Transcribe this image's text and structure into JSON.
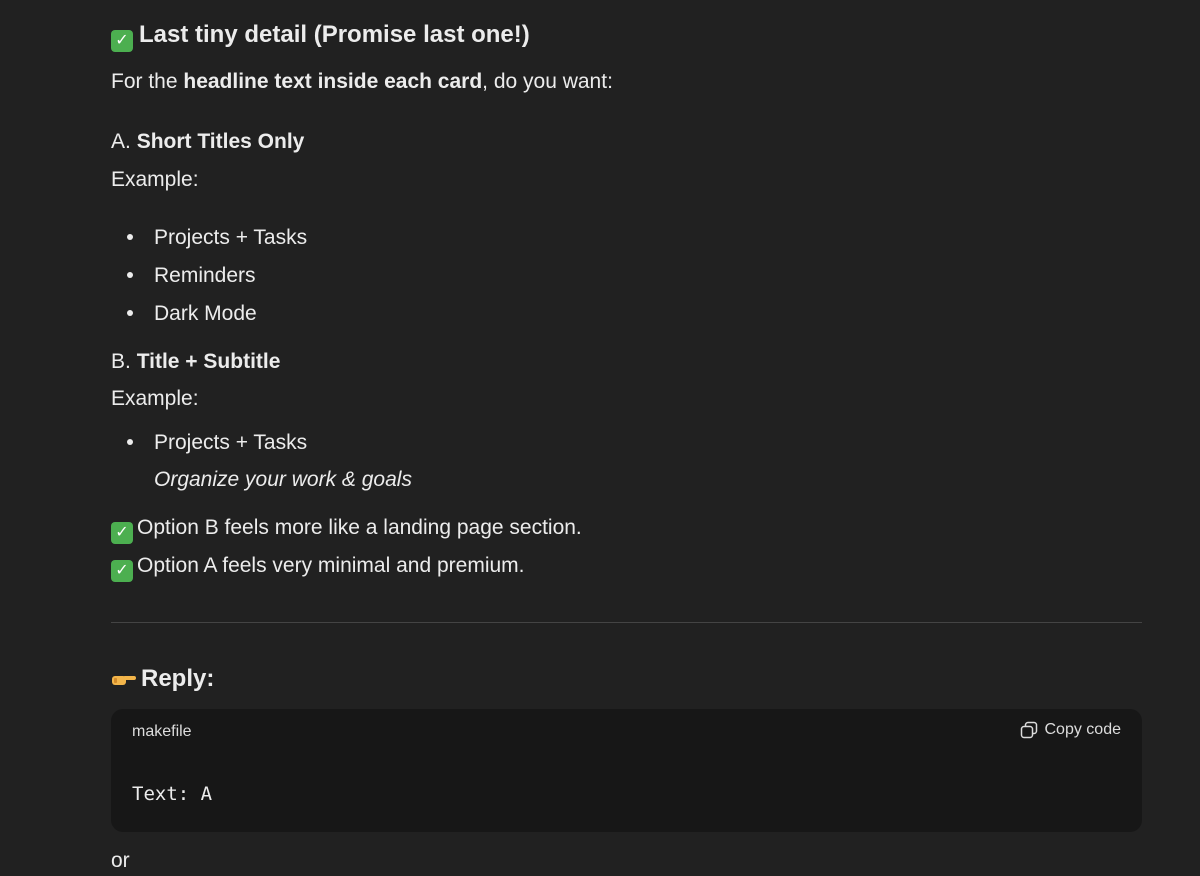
{
  "heading": "Last tiny detail (Promise last one!)",
  "intro": {
    "prefix": "For the ",
    "bold": "headline text inside each card",
    "suffix": ", do you want:"
  },
  "option_a": {
    "letter": "A. ",
    "title": "Short Titles Only",
    "example_label": "Example:",
    "items": [
      "Projects + Tasks",
      "Reminders",
      "Dark Mode"
    ]
  },
  "option_b": {
    "letter": "B. ",
    "title": "Title + Subtitle",
    "example_label": "Example:",
    "item": "Projects + Tasks",
    "subtitle": "Organize your work & goals"
  },
  "notes": [
    "Option B feels more like a landing page section.",
    "Option A feels very minimal and premium."
  ],
  "reply_heading": "Reply:",
  "code_block": {
    "language": "makefile",
    "copy_label": "Copy code",
    "code": "Text: A"
  },
  "trailing_text": "or",
  "colors": {
    "background": "#212121",
    "code_background": "#171717",
    "check_green": "#4caf50"
  },
  "icons": [
    "check-icon",
    "pointing-hand-icon",
    "copy-icon"
  ]
}
